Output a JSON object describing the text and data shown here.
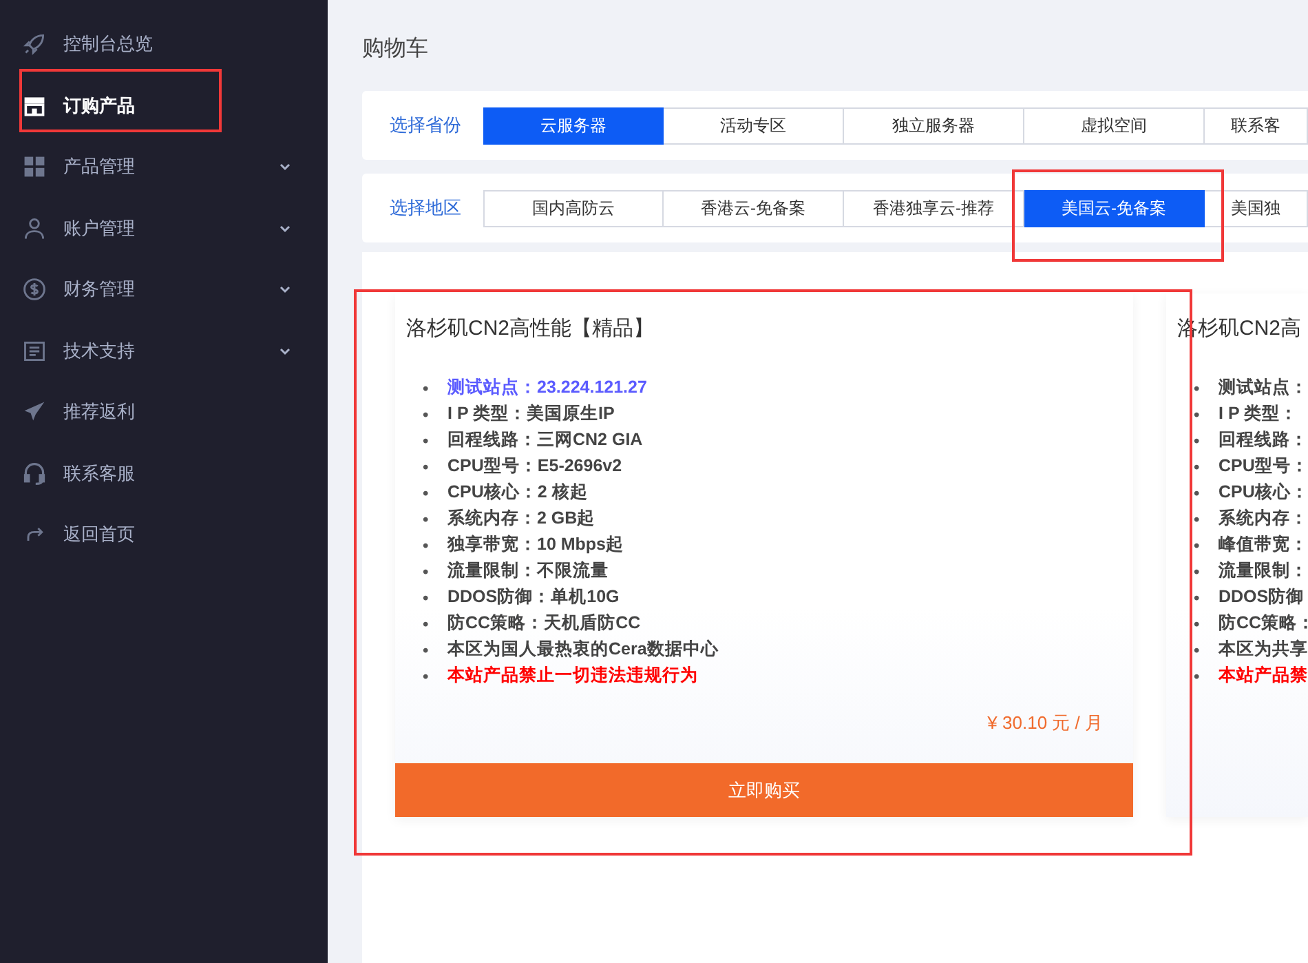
{
  "sidebar": {
    "items": [
      {
        "kind": "rocket",
        "label": "控制台总览",
        "selected": false
      },
      {
        "kind": "store",
        "label": "订购产品",
        "selected": true
      },
      {
        "kind": "grid",
        "label": "产品管理",
        "selected": false,
        "expanded": false
      },
      {
        "kind": "user",
        "label": "账户管理",
        "selected": false,
        "expanded": false
      },
      {
        "kind": "dollar",
        "label": "财务管理",
        "selected": false,
        "expanded": false
      },
      {
        "kind": "doc",
        "label": "技术支持",
        "selected": false,
        "expanded": false
      },
      {
        "kind": "plane",
        "label": "推荐返利",
        "selected": false
      },
      {
        "kind": "headset",
        "label": "联系客服",
        "selected": false
      },
      {
        "kind": "return",
        "label": "返回首页",
        "selected": false
      }
    ]
  },
  "page_title": "购物车",
  "filters": [
    {
      "label": "选择省份",
      "options": [
        {
          "label": "云服务器",
          "selected": true
        },
        {
          "label": "活动专区",
          "selected": false
        },
        {
          "label": "独立服务器",
          "selected": false
        },
        {
          "label": "虚拟空间",
          "selected": false
        },
        {
          "label": "联系客",
          "selected": false
        }
      ]
    },
    {
      "label": "选择地区",
      "options": [
        {
          "label": "国内高防云",
          "selected": false
        },
        {
          "label": "香港云-免备案",
          "selected": false
        },
        {
          "label": "香港独享云-推荐",
          "selected": false
        },
        {
          "label": "美国云-免备案",
          "selected": true
        },
        {
          "label": "美国独",
          "selected": false
        }
      ]
    }
  ],
  "products": [
    {
      "title": "洛杉矶CN2高性能【精品】",
      "features": [
        {
          "kind": "link",
          "label": "测试站点：",
          "value": "23.224.121.27"
        },
        {
          "kind": "plain",
          "label": "I P 类型：",
          "value": "美国原生IP"
        },
        {
          "kind": "plain",
          "label": "回程线路：",
          "value": "三网CN2 GIA"
        },
        {
          "kind": "plain",
          "label": "CPU型号：",
          "value": "E5-2696v2"
        },
        {
          "kind": "plain",
          "label": "CPU核心：",
          "value": "2 核起"
        },
        {
          "kind": "plain",
          "label": "系统内存：",
          "value": "2 GB起"
        },
        {
          "kind": "plain",
          "label": "独享带宽：",
          "value": "10 Mbps起"
        },
        {
          "kind": "plain",
          "label": "流量限制：",
          "value": "不限流量"
        },
        {
          "kind": "plain",
          "label": "DDOS防御：",
          "value": "单机10G"
        },
        {
          "kind": "plain",
          "label": "防CC策略：",
          "value": "天机盾防CC"
        },
        {
          "kind": "plain",
          "label": "本区为国人最热衷的Cera数据中心"
        },
        {
          "kind": "warning",
          "label": "本站产品禁止一切违法违规行为"
        }
      ],
      "bullet": "•",
      "price": "¥ 30.10 元 / 月",
      "button": "立即购买"
    },
    {
      "title": "洛杉矶CN2高",
      "features": [
        {
          "kind": "plain",
          "label": "测试站点："
        },
        {
          "kind": "plain",
          "label": "I P 类型："
        },
        {
          "kind": "plain",
          "label": "回程线路："
        },
        {
          "kind": "plain",
          "label": "CPU型号："
        },
        {
          "kind": "plain",
          "label": "CPU核心："
        },
        {
          "kind": "plain",
          "label": "系统内存："
        },
        {
          "kind": "plain",
          "label": "峰值带宽："
        },
        {
          "kind": "plain",
          "label": "流量限制："
        },
        {
          "kind": "plain",
          "label": "DDOS防御"
        },
        {
          "kind": "plain",
          "label": "防CC策略："
        },
        {
          "kind": "plain",
          "label": "本区为共享"
        },
        {
          "kind": "warning",
          "label": "本站产品禁"
        }
      ],
      "bullet": "•"
    }
  ]
}
